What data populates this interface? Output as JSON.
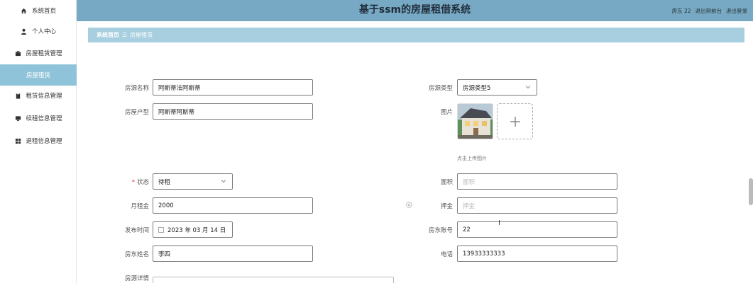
{
  "sidebar": {
    "items": [
      {
        "label": "系统首页",
        "icon": "home-icon"
      },
      {
        "label": "个人中心",
        "icon": "user-icon"
      },
      {
        "label": "房屋租赁管理",
        "icon": "briefcase-icon"
      },
      {
        "label": "房屋租赁",
        "icon": ""
      },
      {
        "label": "租赁信息管理",
        "icon": "clipboard-icon"
      },
      {
        "label": "续租信息管理",
        "icon": "monitor-icon"
      },
      {
        "label": "退租信息管理",
        "icon": "grid-icon"
      }
    ]
  },
  "header": {
    "title": "基于ssm的房屋租借系统",
    "user": "房东 22",
    "to_front": "退出到前台",
    "logout": "退出登录"
  },
  "breadcrumb": {
    "home": "系统首页",
    "sep": "☰",
    "current": "房屋租赁"
  },
  "form": {
    "name_label": "房源名称",
    "name_value": "阿斯蒂法阿斯蒂",
    "type_label": "房源类型",
    "type_value": "房源类型5",
    "layout_label": "房屋户型",
    "layout_value": "阿斯蒂阿斯蒂",
    "image_label": "图片",
    "upload_hint": "点击上传图片",
    "status_label": "状态",
    "status_value": "待租",
    "area_label": "面积",
    "area_placeholder": "面积",
    "rent_label": "月租金",
    "rent_value": "2000",
    "deposit_label": "押金",
    "deposit_placeholder": "押金",
    "date_label": "发布时间",
    "date_value": "2023 年 03 月 14 日",
    "landlord_account_label": "房东账号",
    "landlord_account_value": "22",
    "landlord_name_label": "房东姓名",
    "landlord_name_value": "李四",
    "phone_label": "电话",
    "phone_value": "13933333333",
    "detail_label": "房源详情"
  }
}
